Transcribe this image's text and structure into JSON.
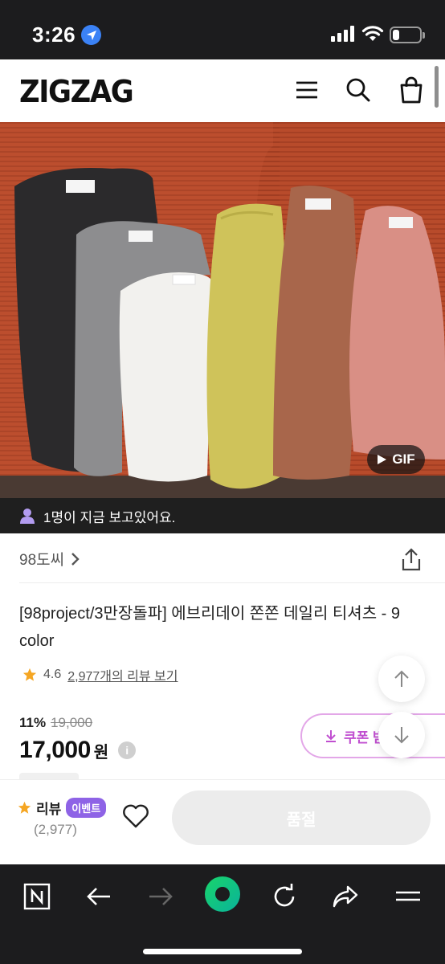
{
  "status_bar": {
    "time": "3:26",
    "icons": [
      "location-arrow-icon",
      "cellular-signal-icon",
      "wifi-icon",
      "battery-icon"
    ],
    "battery_level": 0.25
  },
  "app_header": {
    "logo": "ZIGZAG",
    "icons": [
      "menu-icon",
      "search-icon",
      "shopping-bag-icon"
    ]
  },
  "hero": {
    "gif_badge": "GIF",
    "colors": [
      "#2b2a2c",
      "#8d8d8f",
      "#f2f1ee",
      "#cfc35a",
      "#a8664b",
      "#d98f85",
      "#b34a2c"
    ]
  },
  "viewers": {
    "text": "1명이 지금 보고있어요.",
    "icon": "person-icon"
  },
  "product": {
    "store_name": "98도씨",
    "title": "[98project/3만장돌파] 에브리데이 쫀쫀 데일리 티셔츠 - 9 color",
    "rating": "4.6",
    "review_link": "2,977개의 리뷰 보기",
    "discount_percent": "11%",
    "original_price": "19,000",
    "price": "17,000",
    "currency": "원",
    "info_icon_text": "i",
    "coupon_label": "쿠폰 받",
    "accent_color": "#c04fd0"
  },
  "buy_bar": {
    "review_label": "리뷰",
    "event_badge": "이벤트",
    "review_count": "(2,977)",
    "soldout_label": "품절"
  },
  "browser_toolbar": {
    "icons": [
      "naver-icon",
      "back-arrow-icon",
      "forward-arrow-icon",
      "green-dot-icon",
      "reload-icon",
      "share-arrow-icon",
      "menu-lines-icon"
    ]
  }
}
